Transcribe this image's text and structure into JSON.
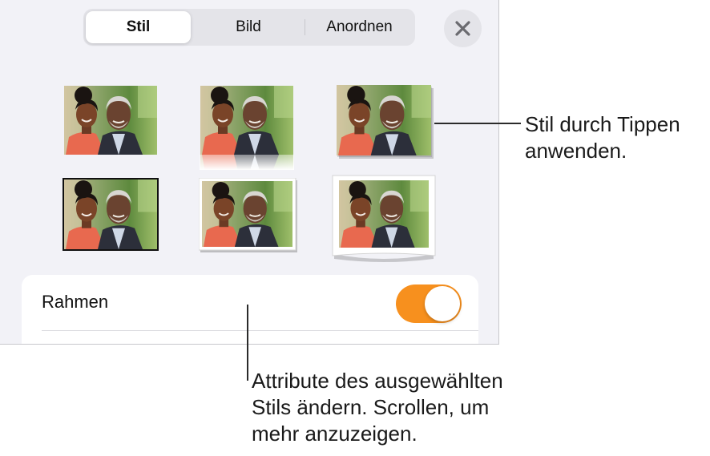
{
  "tabs": [
    {
      "label": "Stil",
      "active": true
    },
    {
      "label": "Bild",
      "active": false
    },
    {
      "label": "Anordnen",
      "active": false
    }
  ],
  "close_button": {
    "icon": "close-icon"
  },
  "style_thumbnails": [
    {
      "style": "plain"
    },
    {
      "style": "reflection"
    },
    {
      "style": "drop-shadow"
    },
    {
      "style": "thin-black-border"
    },
    {
      "style": "white-frame-shadow"
    },
    {
      "style": "curled-white-frame"
    }
  ],
  "settings": {
    "frame_label": "Rahmen",
    "frame_toggle_on": true
  },
  "callouts": {
    "style_tip": [
      "Stil durch Tippen",
      "anwenden."
    ],
    "attributes_tip": [
      "Attribute des ausgewählten",
      "Stils ändern. Scrollen, um",
      "mehr anzuzeigen."
    ]
  },
  "colors": {
    "accent_toggle": "#f7901e",
    "panel_background": "#f2f2f7"
  }
}
